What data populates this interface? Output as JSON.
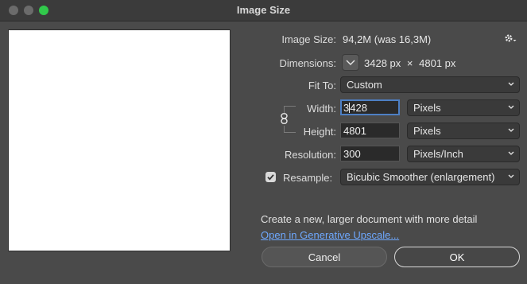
{
  "window": {
    "title": "Image Size"
  },
  "image_size": {
    "label": "Image Size:",
    "value": "94,2M (was 16,3M)"
  },
  "dimensions": {
    "label": "Dimensions:",
    "width_value": "3428",
    "width_unit": "px",
    "times": "×",
    "height_value": "4801",
    "height_unit": "px"
  },
  "fit_to": {
    "label": "Fit To:",
    "selected": "Custom"
  },
  "width": {
    "label": "Width:",
    "value_before_caret": "3",
    "value_after_caret": "428",
    "unit": "Pixels"
  },
  "height": {
    "label": "Height:",
    "value": "4801",
    "unit": "Pixels"
  },
  "resolution": {
    "label": "Resolution:",
    "value": "300",
    "unit": "Pixels/Inch"
  },
  "resample": {
    "label": "Resample:",
    "checked": true,
    "method": "Bicubic Smoother (enlargement)"
  },
  "info": {
    "text": "Create a new, larger document with more detail",
    "link": "Open in Generative Upscale..."
  },
  "buttons": {
    "cancel": "Cancel",
    "ok": "OK"
  },
  "icons": {
    "close": "close-dot-icon",
    "minimize": "minimize-dot-icon",
    "maximize": "maximize-dot-icon",
    "settings": "gear-icon",
    "dimensions_toggle": "chevron-down-icon",
    "constrain": "link-chain-icon",
    "checkmark": "checkmark-icon"
  },
  "colors": {
    "accent": "#4d7fc4",
    "link": "#6ea8fe",
    "maximize": "#31c94b"
  }
}
